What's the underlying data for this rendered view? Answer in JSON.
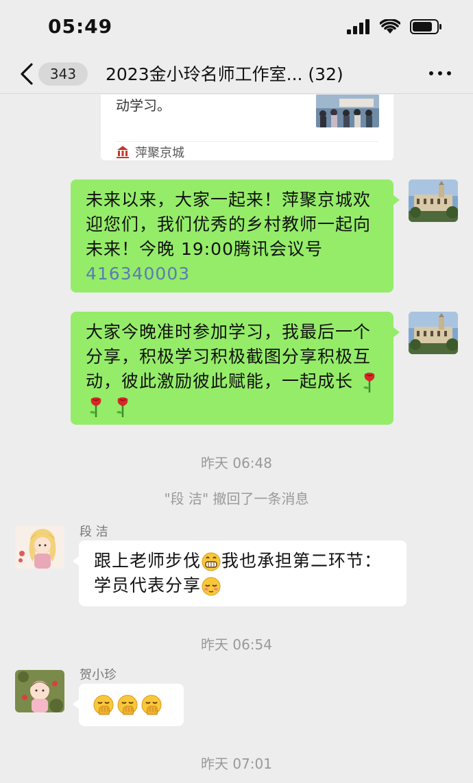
{
  "status_bar": {
    "time": "05:49"
  },
  "nav": {
    "unread_count": "343",
    "title": "2023金小玲名师工作室... (32)"
  },
  "shared_card": {
    "desc_fragment": "动学习。",
    "source": "萍聚京城"
  },
  "messages": [
    {
      "side": "right",
      "text": "未来以来，大家一起来！萍聚京城欢迎您们，我们优秀的乡村教师一起向未来！今晚 19:00腾讯会议号",
      "link": "416340003"
    },
    {
      "side": "right",
      "text": "大家今晚准时参加学习，我最后一个分享，积极学习积极截图分享积极互动，彼此激励彼此赋能，一起成长"
    }
  ],
  "timestamp_1": "昨天 06:48",
  "system_recall": "\"段 洁\" 撤回了一条消息",
  "duan_jie": {
    "name": "段 洁",
    "text_part1": "跟上老师步伐",
    "text_part2": "我也承担第二环节：学员代表分享"
  },
  "timestamp_2": "昨天 06:54",
  "he_xiaozhen": {
    "name": "贺小珍"
  },
  "timestamp_3": "昨天 07:01",
  "colors": {
    "green_bubble": "#95ec69",
    "background": "#ededed",
    "link": "#5b7bb5"
  }
}
